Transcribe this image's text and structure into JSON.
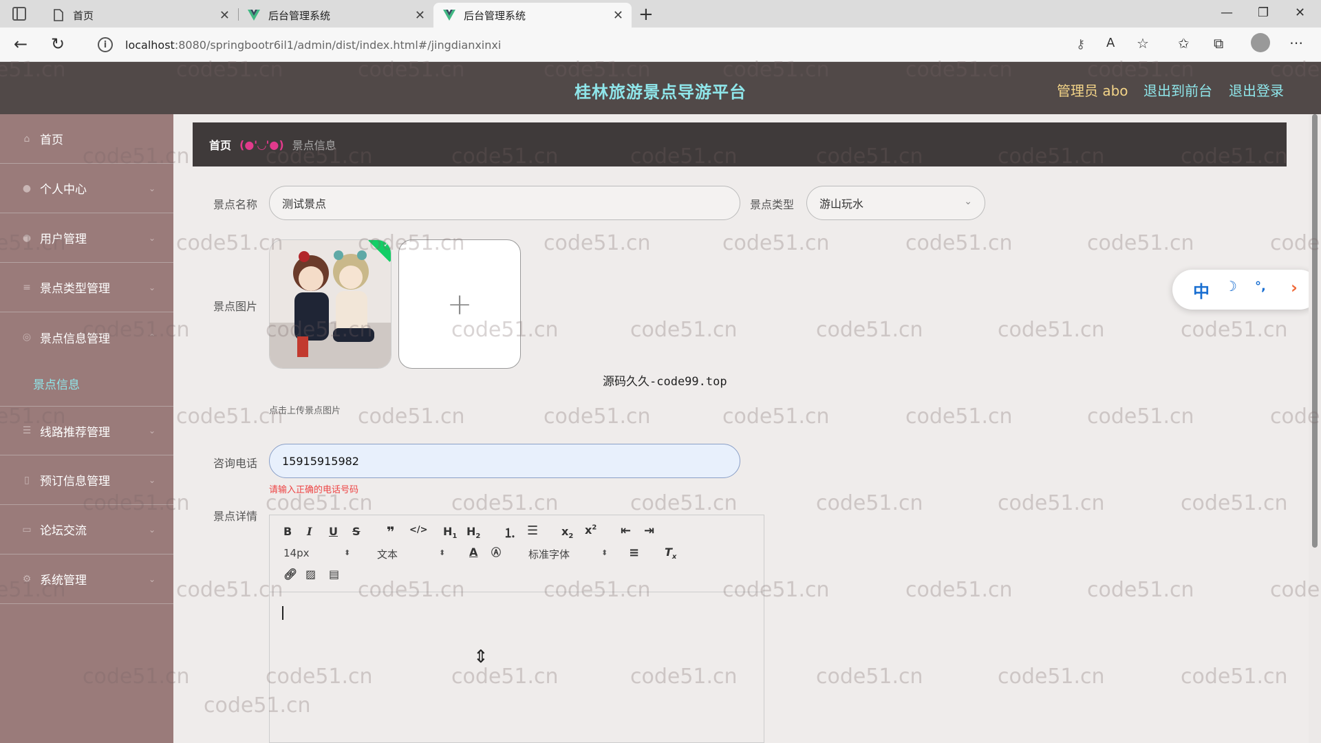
{
  "browser": {
    "tabs": [
      {
        "label": "首页"
      },
      {
        "label": "后台管理系统"
      },
      {
        "label": "后台管理系统"
      }
    ],
    "url_host": "localhost",
    "url_rest": ":8080/springbootr6il1/admin/dist/index.html#/jingdianxinxi"
  },
  "header": {
    "title": "桂林旅游景点导游平台",
    "user": "管理员 abo",
    "to_front": "退出到前台",
    "logout": "退出登录"
  },
  "sidebar": {
    "items": [
      {
        "label": "首页"
      },
      {
        "label": "个人中心"
      },
      {
        "label": "用户管理"
      },
      {
        "label": "景点类型管理"
      },
      {
        "label": "景点信息管理"
      },
      {
        "label": "线路推荐管理"
      },
      {
        "label": "预订信息管理"
      },
      {
        "label": "论坛交流"
      },
      {
        "label": "系统管理"
      }
    ],
    "active_sub": "景点信息"
  },
  "breadcrumb": {
    "home": "首页",
    "sep": "(●'◡'●)",
    "current": "景点信息"
  },
  "form": {
    "name_label": "景点名称",
    "name_value": "测试景点",
    "type_label": "景点类型",
    "type_value": "游山玩水",
    "image_label": "景点图片",
    "upload_tip": "点击上传景点图片",
    "center_note": "源码久久-code99.top",
    "phone_label": "咨询电话",
    "phone_value": "15915915982",
    "phone_error": "请输入正确的电话号码",
    "detail_label": "景点详情"
  },
  "editor": {
    "font_size": "14px",
    "block": "文本",
    "font_family": "标准字体"
  },
  "watermark": "code51.cn",
  "colors": {
    "header_bg": "#514948",
    "title": "#8fe6ea",
    "user": "#f3d488",
    "sidebar_bg": "#9a7b7a"
  }
}
